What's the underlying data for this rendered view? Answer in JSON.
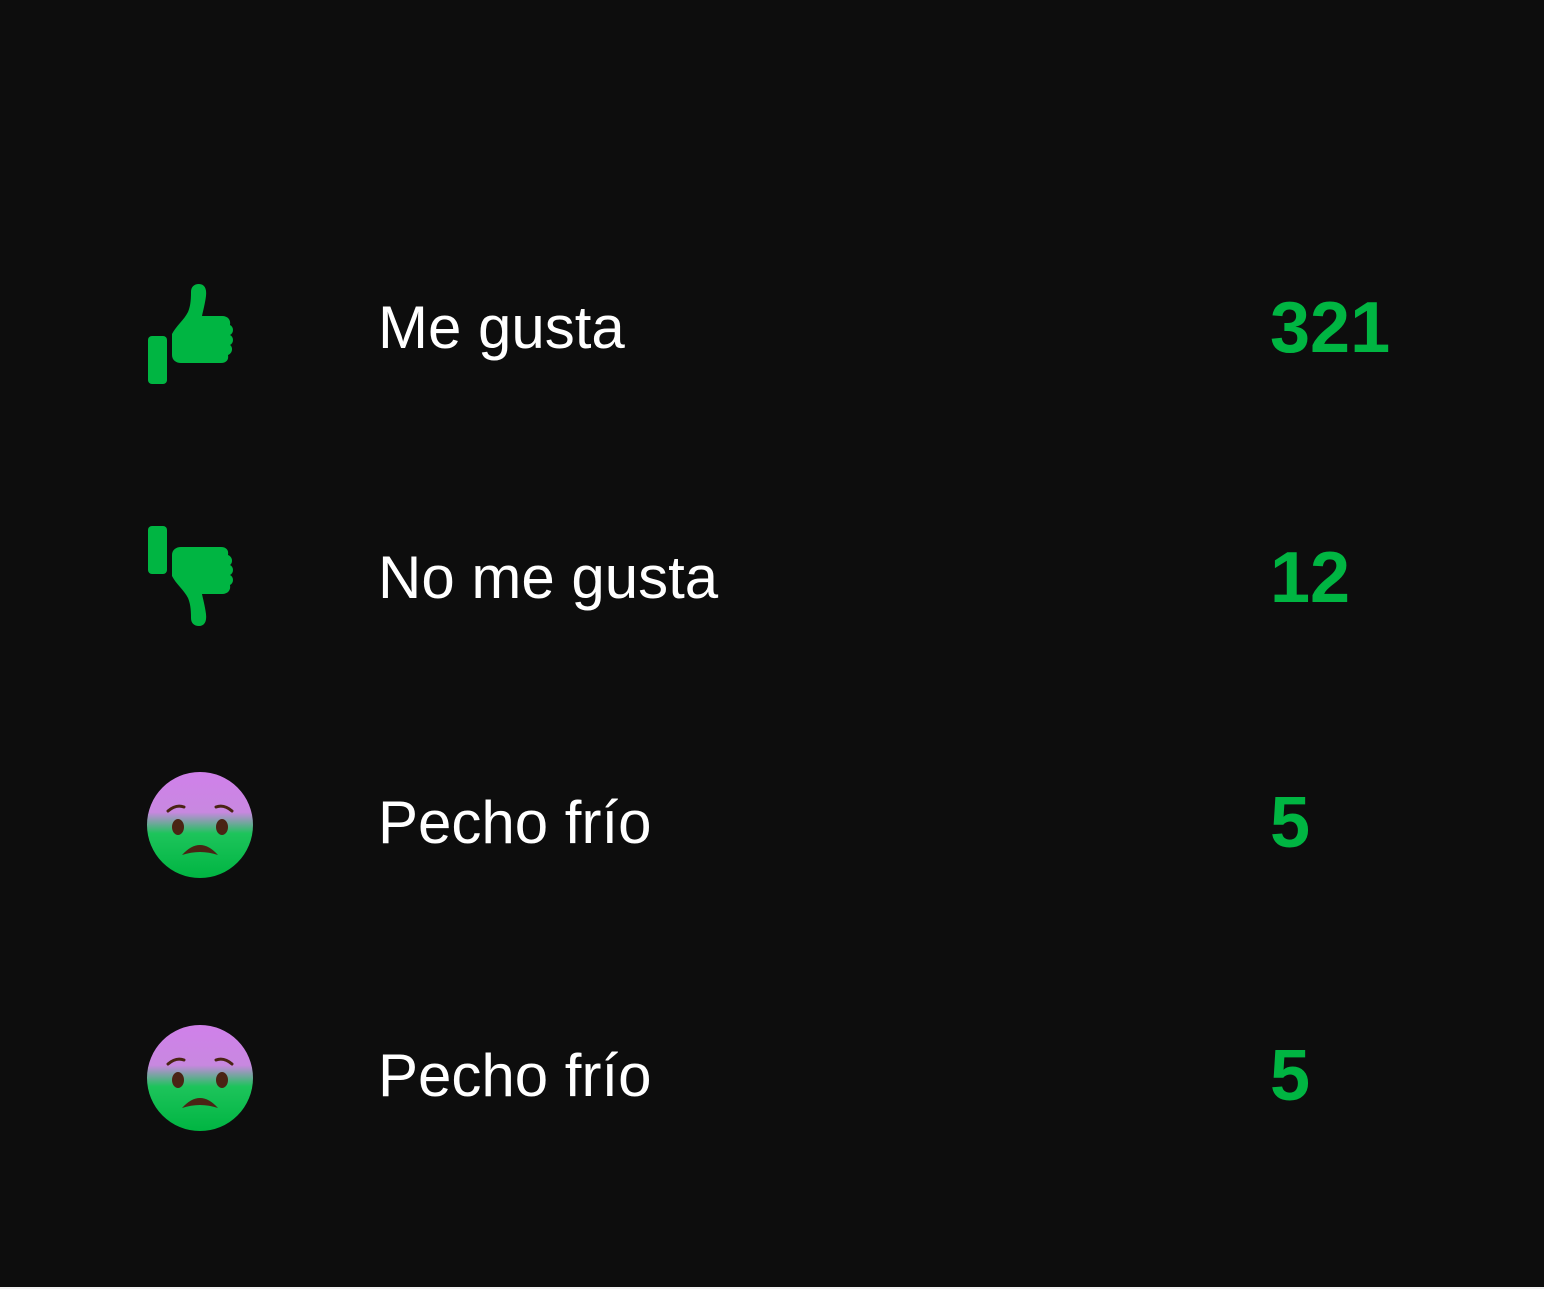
{
  "colors": {
    "background": "#0d0d0d",
    "label": "#ffffff",
    "accent_green": "#00b542",
    "face_top_purple": "#d080ea",
    "face_feature": "#4a2414"
  },
  "reactions": [
    {
      "icon": "thumbs-up-icon",
      "label": "Me gusta",
      "count": "321"
    },
    {
      "icon": "thumbs-down-icon",
      "label": "No me gusta",
      "count": "12"
    },
    {
      "icon": "cold-face-icon",
      "label": "Pecho frío",
      "count": "5"
    },
    {
      "icon": "cold-face-icon",
      "label": "Pecho frío",
      "count": "5"
    }
  ]
}
